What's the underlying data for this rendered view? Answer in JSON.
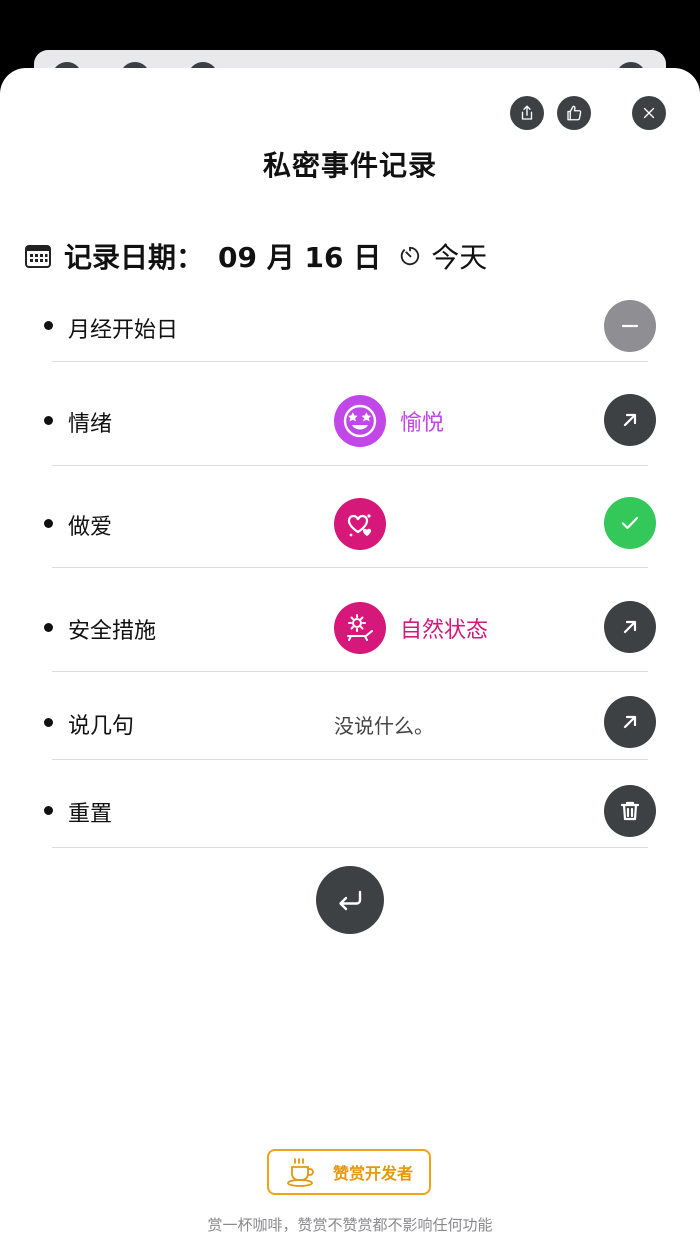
{
  "header": {
    "title": "私密事件记录",
    "share_icon": "share-icon",
    "like_icon": "thumbs-up-icon",
    "close_icon": "close-icon"
  },
  "date": {
    "label": "记录日期：",
    "value": "09 月 16 日",
    "today_label": "今天"
  },
  "rows": [
    {
      "label": "月经开始日",
      "mid_text": "",
      "mid_icon": "",
      "action": "minus-icon",
      "action_color": "#8e8e93"
    },
    {
      "label": "情绪",
      "mid_text": "愉悦",
      "mid_icon": "star-struck-face-icon",
      "mid_color": "#c247e8",
      "action": "arrow-up-right-icon",
      "action_color": "#3d4144"
    },
    {
      "label": "做爱",
      "mid_text": "",
      "mid_icon": "hearts-icon",
      "mid_color": "#d6187a",
      "action": "check-icon",
      "action_color": "#34c759"
    },
    {
      "label": "安全措施",
      "mid_text": "自然状态",
      "mid_icon": "sun-bed-icon",
      "mid_color": "#d6187a",
      "action": "arrow-up-right-icon",
      "action_color": "#3d4144"
    },
    {
      "label": "说几句",
      "mid_text": "没说什么。",
      "action": "arrow-up-right-icon",
      "action_color": "#3d4144"
    },
    {
      "label": "重置",
      "mid_text": "",
      "action": "trash-icon",
      "action_color": "#3d4144"
    }
  ],
  "return_icon": "return-arrow-icon",
  "donate": {
    "label": "赞赏开发者",
    "icon": "coffee-cup-icon",
    "color": "#f2a21a"
  },
  "footer": "赏一杯咖啡，赞赏不赞赏都不影响任何功能"
}
